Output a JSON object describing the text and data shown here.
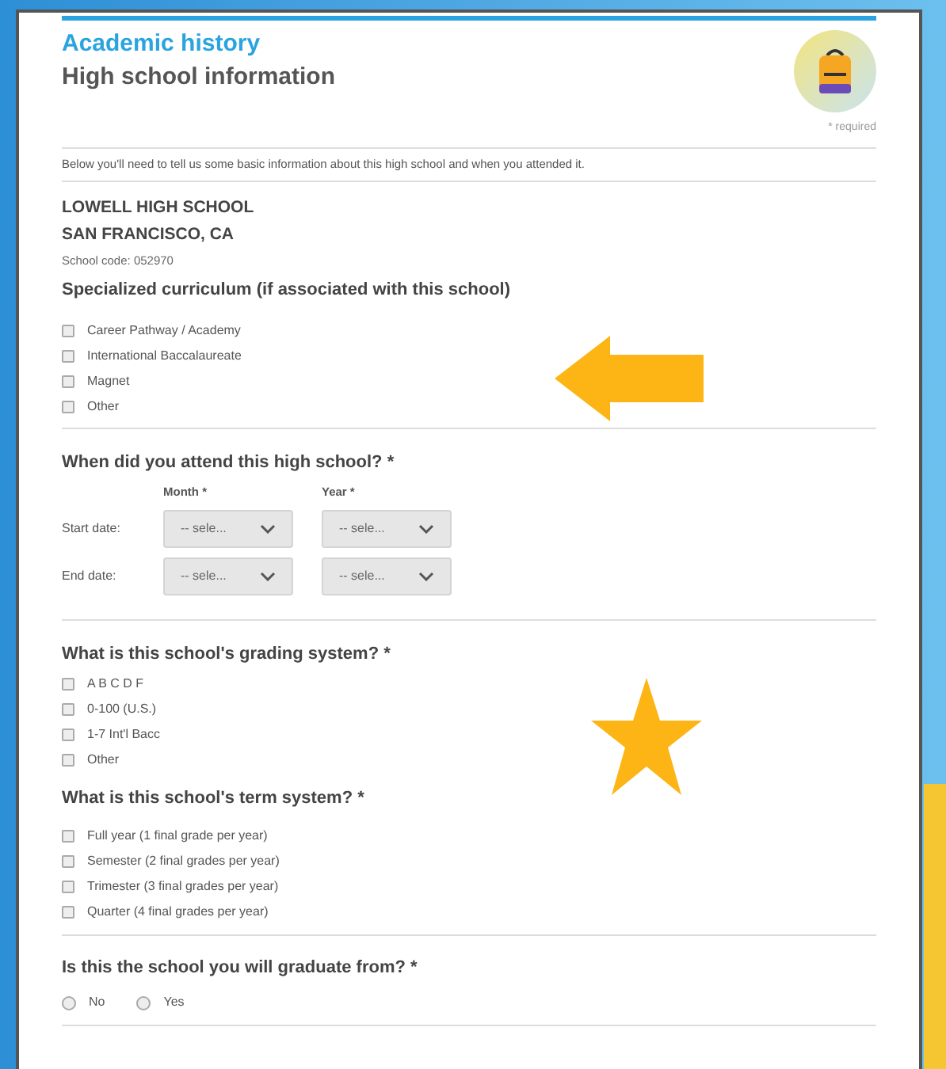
{
  "header": {
    "section": "Academic history",
    "title": "High school information",
    "required_note": "* required"
  },
  "intro": "Below you'll need to tell us some basic information about this high school and when you attended it.",
  "school": {
    "name": "LOWELL HIGH SCHOOL",
    "location": "SAN FRANCISCO, CA",
    "code": "School code: 052970"
  },
  "curriculum": {
    "heading": "Specialized curriculum (if associated with this school)",
    "options": [
      {
        "label": "Career Pathway / Academy",
        "checked": false
      },
      {
        "label": "International Baccalaureate",
        "checked": false
      },
      {
        "label": "Magnet",
        "checked": false
      },
      {
        "label": "Other",
        "checked": false
      }
    ]
  },
  "attendance": {
    "heading": "When did you attend this high school? *",
    "columns": [
      "Month *",
      "Year *"
    ],
    "rows": [
      {
        "label": "Start date:",
        "selects": [
          "-- sele...",
          "-- sele..."
        ]
      },
      {
        "label": "End date:",
        "selects": [
          "-- sele...",
          "-- sele..."
        ]
      }
    ]
  },
  "grading": {
    "heading": "What is this school's grading system? *",
    "options": [
      {
        "label": "A B C D F",
        "checked": false
      },
      {
        "label": "0-100 (U.S.)",
        "checked": false
      },
      {
        "label": "1-7 Int'l Bacc",
        "checked": false
      },
      {
        "label": "Other",
        "checked": false
      }
    ]
  },
  "term": {
    "heading": "What is this school's term system? *",
    "options": [
      {
        "label": "Full year (1 final grade per year)",
        "checked": false
      },
      {
        "label": "Semester (2 final grades per year)",
        "checked": false
      },
      {
        "label": "Trimester (3 final grades per year)",
        "checked": false
      },
      {
        "label": "Quarter (4 final grades per year)",
        "checked": false
      }
    ]
  },
  "graduate": {
    "heading": "Is this the school you will graduate from? *",
    "options": [
      {
        "label": "No",
        "selected": false
      },
      {
        "label": "Yes",
        "selected": false
      }
    ]
  }
}
